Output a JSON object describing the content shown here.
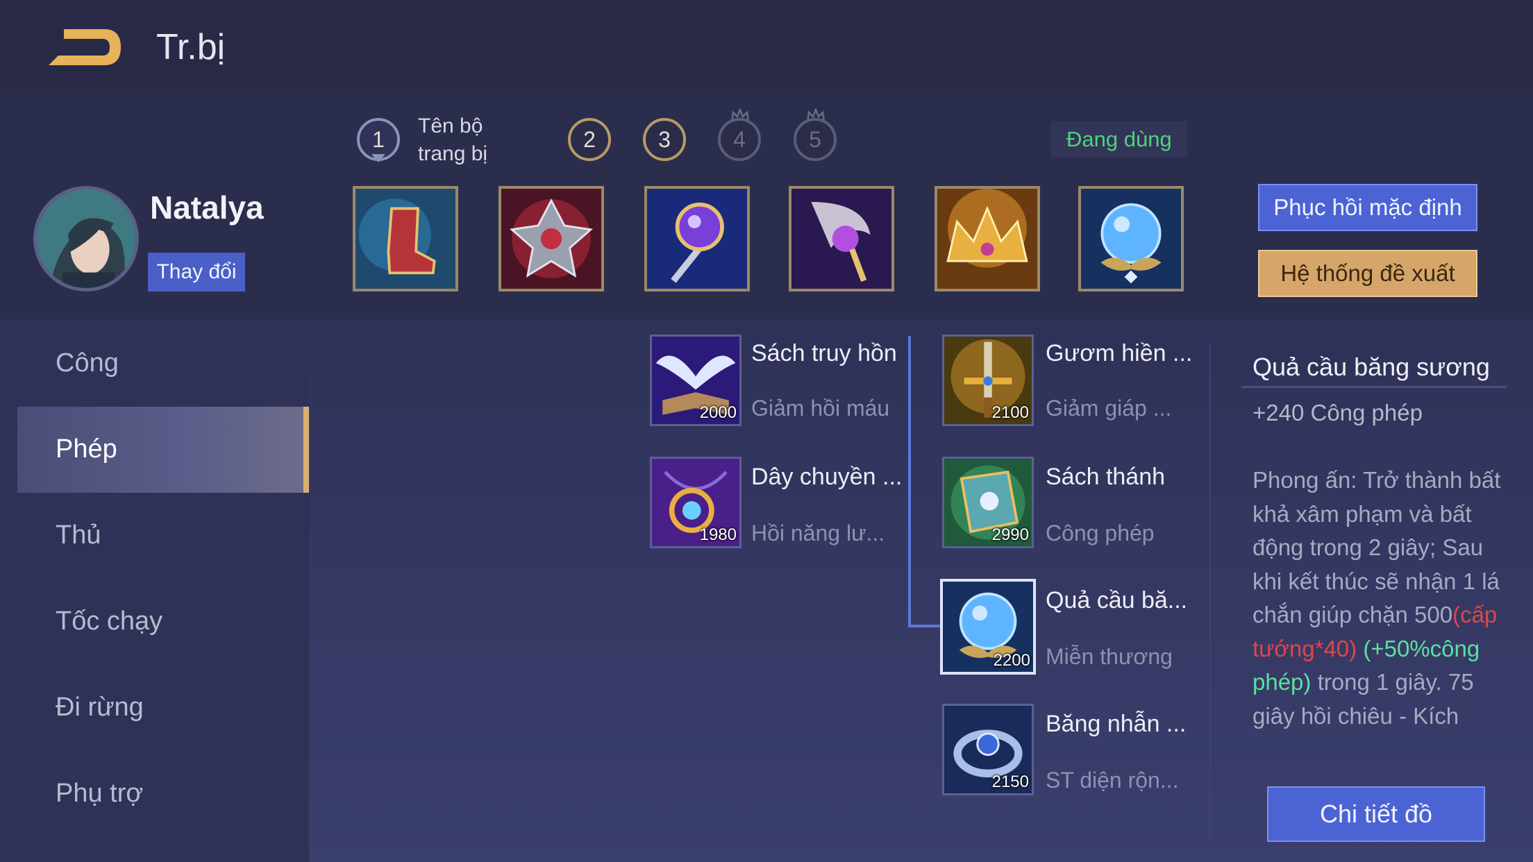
{
  "header": {
    "title": "Tr.bị"
  },
  "loadout_tabs": [
    {
      "number": "1",
      "label_line1": "Tên bộ",
      "label_line2": "trang bị",
      "state": "active"
    },
    {
      "number": "2",
      "state": "normal"
    },
    {
      "number": "3",
      "state": "normal"
    },
    {
      "number": "4",
      "state": "locked"
    },
    {
      "number": "5",
      "state": "locked"
    }
  ],
  "in_use_label": "Đang dùng",
  "hero": {
    "name": "Natalya",
    "change_label": "Thay đổi"
  },
  "build_slots": [
    "boots-icon",
    "spiked-armor-icon",
    "orb-staff-icon",
    "crystal-scepter-icon",
    "golden-crown-icon",
    "frost-orb-icon"
  ],
  "actions": {
    "restore_default": "Phục hồi mặc định",
    "suggested": "Hệ thống đề xuất"
  },
  "menu": [
    "Công",
    "Phép",
    "Thủ",
    "Tốc chạy",
    "Đi rừng",
    "Phụ trợ"
  ],
  "menu_active": "Phép",
  "catalog": {
    "left": [
      {
        "name": "Sách truy hồn",
        "desc": "Giảm hồi máu",
        "price": "2000",
        "icon": "winged-book-icon"
      },
      {
        "name": "Dây chuyền ...",
        "desc": "Hồi năng lư...",
        "price": "1980",
        "icon": "amulet-icon"
      }
    ],
    "right": [
      {
        "name": "Gươm hiền ...",
        "desc": "Giảm giáp ...",
        "price": "2100",
        "icon": "sword-icon"
      },
      {
        "name": "Sách thánh",
        "desc": "Công phép",
        "price": "2990",
        "icon": "holy-book-icon"
      },
      {
        "name": "Quả cầu bă...",
        "desc": "Miễn thương",
        "price": "2200",
        "icon": "frost-orb-icon",
        "selected": true
      },
      {
        "name": "Băng nhẫn ...",
        "desc": "ST diện rộn...",
        "price": "2150",
        "icon": "ice-ring-icon"
      }
    ]
  },
  "detail": {
    "title": "Quả cầu băng sương",
    "stat": "+240 Công phép",
    "text_1": "Phong ấn: Trở thành bất khả xâm phạm và bất động trong 2 giây; Sau khi kết thúc sẽ nhận 1 lá chắn giúp chặn 500",
    "text_red": "(cấp tướng*40)",
    "text_green": " (+50%công phép)",
    "text_2": " trong 1 giây. 75 giây hồi chiêu - Kích",
    "button": "Chi tiết đồ"
  },
  "colors": {
    "accent_blue": "#4c63d4",
    "accent_gold": "#d6a56a",
    "in_use_green": "#4fd27a",
    "highlight_red": "#e0454a",
    "highlight_green": "#5be09f"
  }
}
